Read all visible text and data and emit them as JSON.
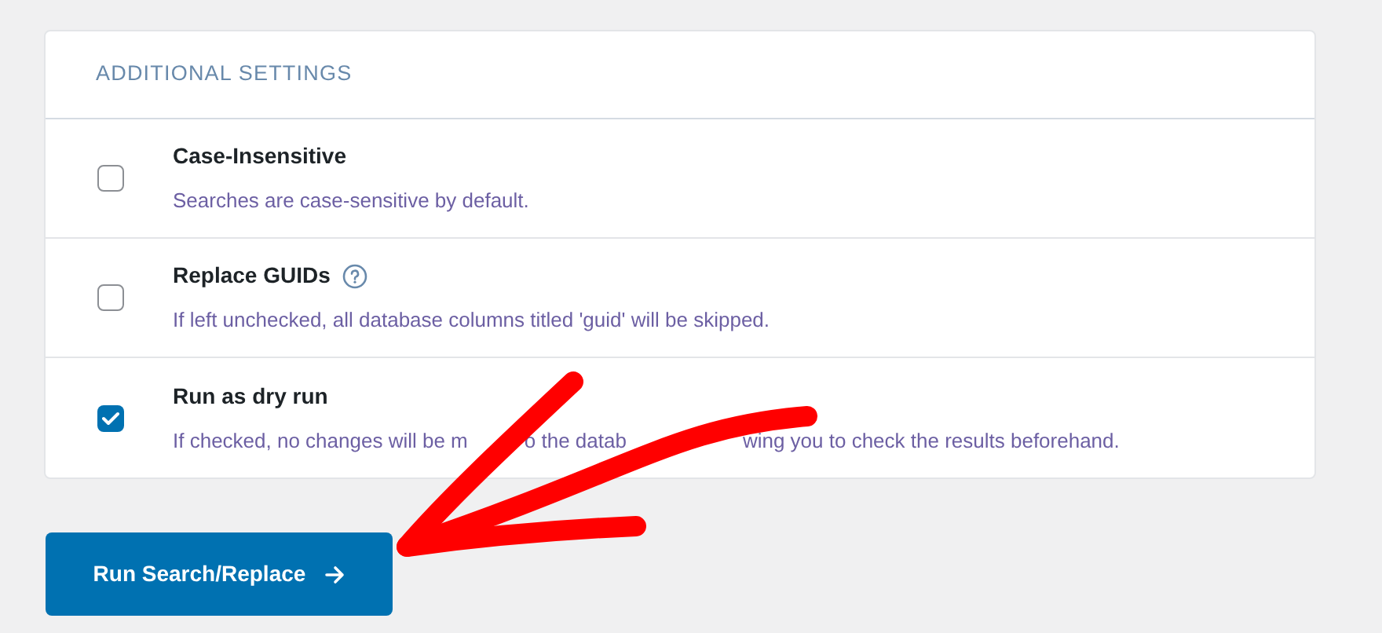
{
  "card": {
    "heading": "ADDITIONAL SETTINGS",
    "options": [
      {
        "label": "Case-Insensitive",
        "help": false,
        "checked": false,
        "description": [
          "Searches are case-sensitive by default."
        ]
      },
      {
        "label": "Replace GUIDs",
        "help": true,
        "checked": false,
        "description": [
          "If left unchecked, all database columns titled 'guid' will be skipped."
        ]
      },
      {
        "label": "Run as dry run",
        "help": false,
        "checked": true,
        "description": [
          "If checked, no changes will be m",
          "o the datab",
          "wing you to check the results beforehand."
        ]
      }
    ]
  },
  "button": {
    "label": "Run Search/Replace"
  }
}
